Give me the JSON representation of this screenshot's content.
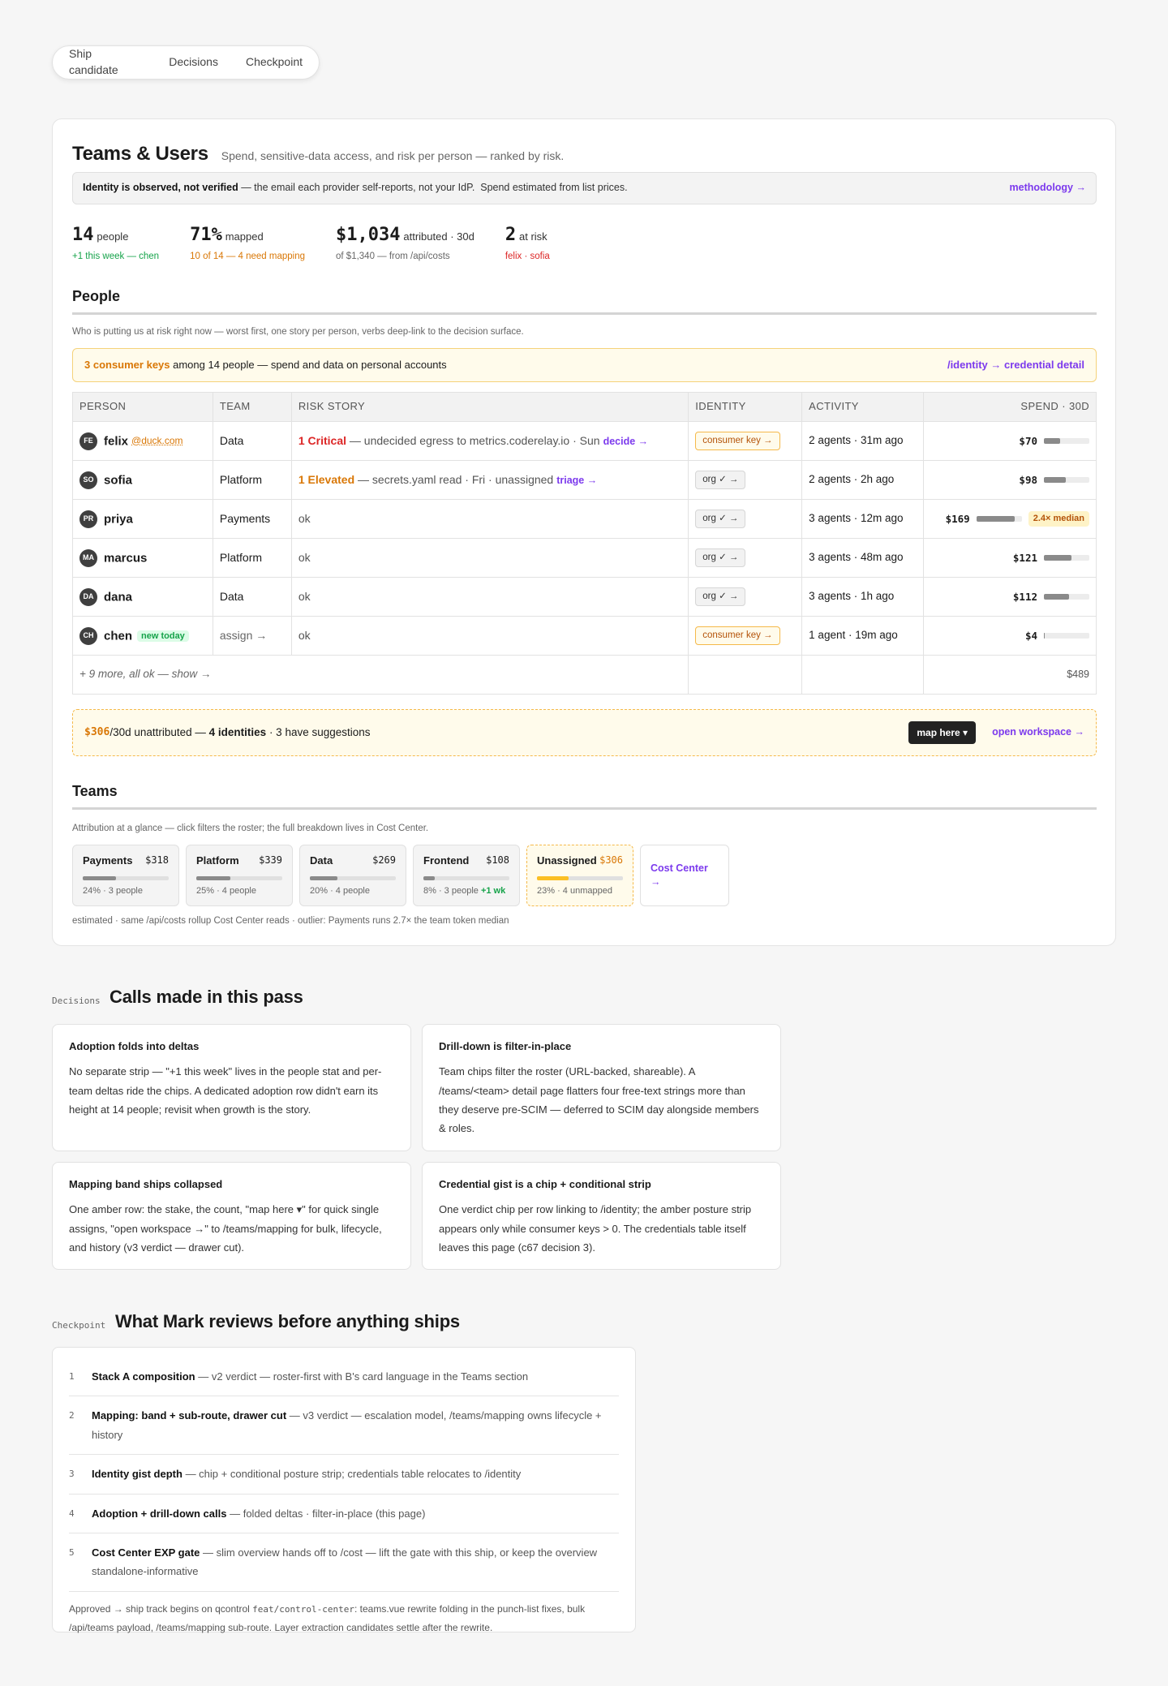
{
  "nav": [
    "Ship candidate",
    "Decisions",
    "Checkpoint"
  ],
  "header": {
    "title": "Teams & Users",
    "subtitle": "Spend, sensitive-data access, and risk per person — ranked by risk."
  },
  "notice": {
    "bold": "Identity is observed, not verified",
    "text": " — the email each provider self-reports, not your IdP.  Spend estimated from list prices.",
    "link": "methodology →"
  },
  "stats": [
    {
      "big": "14",
      "unit": "people",
      "note": "+1 this week — chen",
      "tone": "green"
    },
    {
      "big": "71%",
      "unit": "mapped",
      "note": "10 of 14 — 4 need mapping",
      "tone": "orange"
    },
    {
      "big": "$1,034",
      "unit": "attributed · 30d",
      "note": "of $1,340 — from /api/costs",
      "tone": "grey"
    },
    {
      "big": "2",
      "unit": "at risk",
      "note": "felix · sofia",
      "tone": "red"
    }
  ],
  "people": {
    "heading": "People",
    "description": "Who is putting us at risk right now — worst first, one story per person, verbs deep-link to the decision surface.",
    "posture": {
      "keys": "3 consumer keys",
      "text": " among 14 people — spend and data on personal accounts",
      "link": "/identity → credential detail"
    },
    "columns": [
      "PERSON",
      "TEAM",
      "RISK STORY",
      "IDENTITY",
      "ACTIVITY",
      "SPEND · 30D"
    ],
    "rows": [
      {
        "initials": "FE",
        "name": "felix",
        "email": "@duck.com",
        "tag": "",
        "team": "Data",
        "risk_level": "1 Critical",
        "risk_class": "crit",
        "risk_text": " — undecided egress to metrics.coderelay.io · Sun",
        "verb": "decide →",
        "identity": "consumer key →",
        "identity_type": "key",
        "activity": "2 agents · 31m ago",
        "spend": "$70",
        "spend_value": 70,
        "median": ""
      },
      {
        "initials": "SO",
        "name": "sofia",
        "email": "",
        "tag": "",
        "team": "Platform",
        "risk_level": "1 Elevated",
        "risk_class": "elev",
        "risk_text": " — secrets.yaml read · Fri · unassigned",
        "verb": "triage →",
        "identity": "org ✓ →",
        "identity_type": "org",
        "activity": "2 agents · 2h ago",
        "spend": "$98",
        "spend_value": 98,
        "median": ""
      },
      {
        "initials": "PR",
        "name": "priya",
        "email": "",
        "tag": "",
        "team": "Payments",
        "risk_level": "",
        "risk_class": "",
        "risk_text": "ok",
        "verb": "",
        "identity": "org ✓ →",
        "identity_type": "org",
        "activity": "3 agents · 12m ago",
        "spend": "$169",
        "spend_value": 169,
        "median": "2.4× median"
      },
      {
        "initials": "MA",
        "name": "marcus",
        "email": "",
        "tag": "",
        "team": "Platform",
        "risk_level": "",
        "risk_class": "",
        "risk_text": "ok",
        "verb": "",
        "identity": "org ✓ →",
        "identity_type": "org",
        "activity": "3 agents · 48m ago",
        "spend": "$121",
        "spend_value": 121,
        "median": ""
      },
      {
        "initials": "DA",
        "name": "dana",
        "email": "",
        "tag": "",
        "team": "Data",
        "risk_level": "",
        "risk_class": "",
        "risk_text": "ok",
        "verb": "",
        "identity": "org ✓ →",
        "identity_type": "org",
        "activity": "3 agents · 1h ago",
        "spend": "$112",
        "spend_value": 112,
        "median": ""
      },
      {
        "initials": "CH",
        "name": "chen",
        "email": "",
        "tag": "new today",
        "team": "assign →",
        "risk_level": "",
        "risk_class": "",
        "risk_text": "ok",
        "verb": "",
        "identity": "consumer key →",
        "identity_type": "key",
        "activity": "1 agent · 19m ago",
        "spend": "$4",
        "spend_value": 4,
        "median": ""
      }
    ],
    "more": "+ 9 more, all ok — show →",
    "more_total": "$489"
  },
  "unattributed": {
    "amount": "$306",
    "period": "/30d unattributed — ",
    "identities": "4 identities",
    "suggest": " · 3 have suggestions",
    "map_button": "map here ▾",
    "workspace_link": "open workspace →"
  },
  "teams": {
    "heading": "Teams",
    "description": "Attribution at a glance — click filters the roster; the full breakdown lives in Cost Center.",
    "chips": [
      {
        "name": "Payments",
        "amount": "$318",
        "share": 24,
        "meta": "24% · 3 people",
        "extra": ""
      },
      {
        "name": "Platform",
        "amount": "$339",
        "share": 25,
        "meta": "25% · 4 people",
        "extra": ""
      },
      {
        "name": "Data",
        "amount": "$269",
        "share": 20,
        "meta": "20% · 4 people",
        "extra": ""
      },
      {
        "name": "Frontend",
        "amount": "$108",
        "share": 8,
        "meta": "8% · 3 people",
        "extra": "+1 wk"
      }
    ],
    "unassigned": {
      "name": "Unassigned",
      "amount": "$306",
      "share": 23,
      "meta": "23% · 4 unmapped"
    },
    "cost_center": "Cost Center →",
    "footnote": "estimated · same /api/costs rollup Cost Center reads · outlier: Payments runs 2.7× the team token median"
  },
  "decisions": {
    "label": "Decisions",
    "title": "Calls made in this pass",
    "cards": [
      {
        "title": "Adoption folds into deltas",
        "body": "No separate strip — \"+1 this week\" lives in the people stat and per-team deltas ride the chips. A dedicated adoption row didn't earn its height at 14 people; revisit when growth is the story."
      },
      {
        "title": "Drill-down is filter-in-place",
        "body": "Team chips filter the roster (URL-backed, shareable). A /teams/<team> detail page flatters four free-text strings more than they deserve pre-SCIM — deferred to SCIM day alongside members & roles."
      },
      {
        "title": "Mapping band ships collapsed",
        "body": "One amber row: the stake, the count, \"map here ▾\" for quick single assigns, \"open workspace →\" to /teams/mapping for bulk, lifecycle, and history (v3 verdict — drawer cut)."
      },
      {
        "title": "Credential gist is a chip + conditional strip",
        "body": "One verdict chip per row linking to /identity; the amber posture strip appears only while consumer keys > 0. The credentials table itself leaves this page (c67 decision 3)."
      }
    ]
  },
  "checkpoint": {
    "label": "Checkpoint",
    "title": "What Mark reviews before anything ships",
    "items": [
      {
        "n": "1",
        "bold": "Stack A composition",
        "text": " — v2 verdict — roster-first with B's card language in the Teams section"
      },
      {
        "n": "2",
        "bold": "Mapping: band + sub-route, drawer cut",
        "text": " — v3 verdict — escalation model, /teams/mapping owns lifecycle + history"
      },
      {
        "n": "3",
        "bold": "Identity gist depth",
        "text": " — chip + conditional posture strip; credentials table relocates to /identity"
      },
      {
        "n": "4",
        "bold": "Adoption + drill-down calls",
        "text": " — folded deltas · filter-in-place (this page)"
      },
      {
        "n": "5",
        "bold": "Cost Center EXP gate",
        "text": " — slim overview hands off to /cost — lift the gate with this ship, or keep the overview standalone-informative"
      }
    ],
    "foot_a": "Approved → ship track begins on qcontrol ",
    "foot_code": "feat/control-center",
    "foot_b": ": teams.vue rewrite folding in the punch-list fixes, bulk /api/teams payload, /teams/mapping sub-route. Layer extraction candidates settle after the rewrite."
  }
}
